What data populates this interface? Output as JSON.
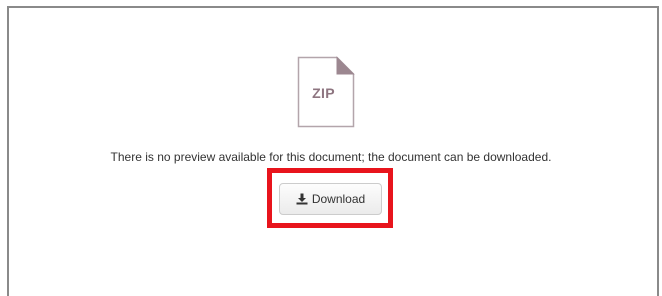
{
  "preview": {
    "file_type_label": "ZIP",
    "file_icon": "zip-file-icon",
    "message": "There is no preview available for this document; the document can be downloaded.",
    "download_label": "Download",
    "download_icon": "download-icon",
    "highlight_color": "#e8141c",
    "icon_color": "#8e7580"
  }
}
